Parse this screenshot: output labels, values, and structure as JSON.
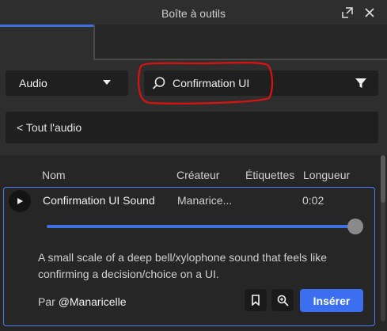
{
  "window": {
    "title": "Boîte à outils"
  },
  "filters": {
    "category_selected": "Audio",
    "search_value": "Confirmation UI",
    "back_label": "< Tout l'audio"
  },
  "columns": {
    "name": "Nom",
    "creator": "Créateur",
    "tags": "Étiquettes",
    "length": "Longueur"
  },
  "selected_item": {
    "name": "Confirmation UI Sound",
    "creator": "Manarice...",
    "length": "0:02",
    "progress": 1.0,
    "description": "A small scale of a deep bell/xylophone sound that feels like confirming a decision/choice on a UI.",
    "by_prefix": "Par",
    "by_user": "@Manaricelle",
    "insert_label": "Insérer"
  },
  "colors": {
    "accent": "#3b6ff0",
    "annotation": "#e01010",
    "background": "#2e2e2e"
  },
  "icons": [
    "float-icon",
    "close-icon",
    "chevron-down-icon",
    "search-icon",
    "filter-icon",
    "play-icon",
    "bookmark-icon",
    "zoom-icon"
  ]
}
